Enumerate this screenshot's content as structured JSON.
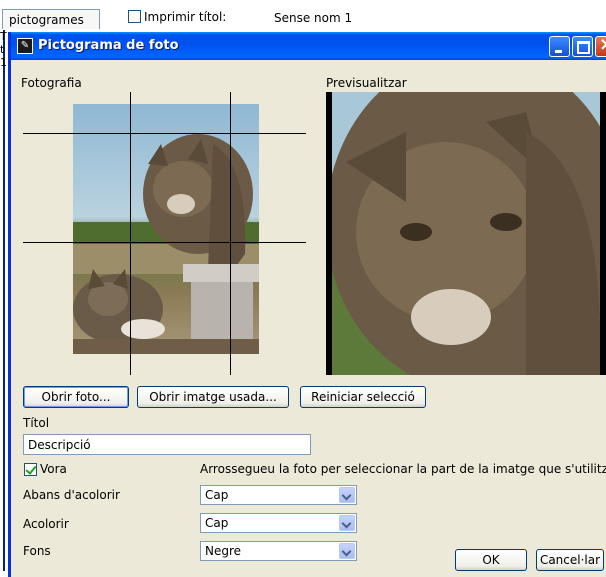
{
  "background_app": {
    "tab_label": "pictogrames",
    "print_title_label": "Imprimir títol:",
    "document_name": "Sense nom 1",
    "side_marks": [
      "T",
      "",
      "t",
      "1"
    ]
  },
  "dialog": {
    "title": "Pictograma de foto",
    "photo_label": "Fotografia",
    "preview_label": "Previsualitzar",
    "buttons": {
      "open_photo": "Obrir foto...",
      "open_used_image": "Obrir imatge usada...",
      "reset_selection": "Reiniciar selecció",
      "ok": "OK",
      "cancel": "Cancel·lar"
    },
    "title_field": {
      "label": "Títol",
      "value": "Descripció"
    },
    "border_checkbox": {
      "label": "Vora",
      "checked": true
    },
    "hint": "Arrossegueu la foto per seleccionar la part de la imatge que s'utilitzarà en e",
    "before_coloring": {
      "label": "Abans d'acolorir",
      "value": "Cap"
    },
    "coloring": {
      "label": "Acolorir",
      "value": "Cap"
    },
    "background": {
      "label": "Fons",
      "value": "Negre"
    }
  },
  "icons": {
    "app": "pictogram-app-icon",
    "minimize": "minimize-icon",
    "maximize": "maximize-icon",
    "close": "close-icon",
    "dropdown": "chevron-down-icon"
  },
  "colors": {
    "titlebar": "#0053ee",
    "dialog_bg": "#ece9d8",
    "preview_bg": "#000000"
  }
}
